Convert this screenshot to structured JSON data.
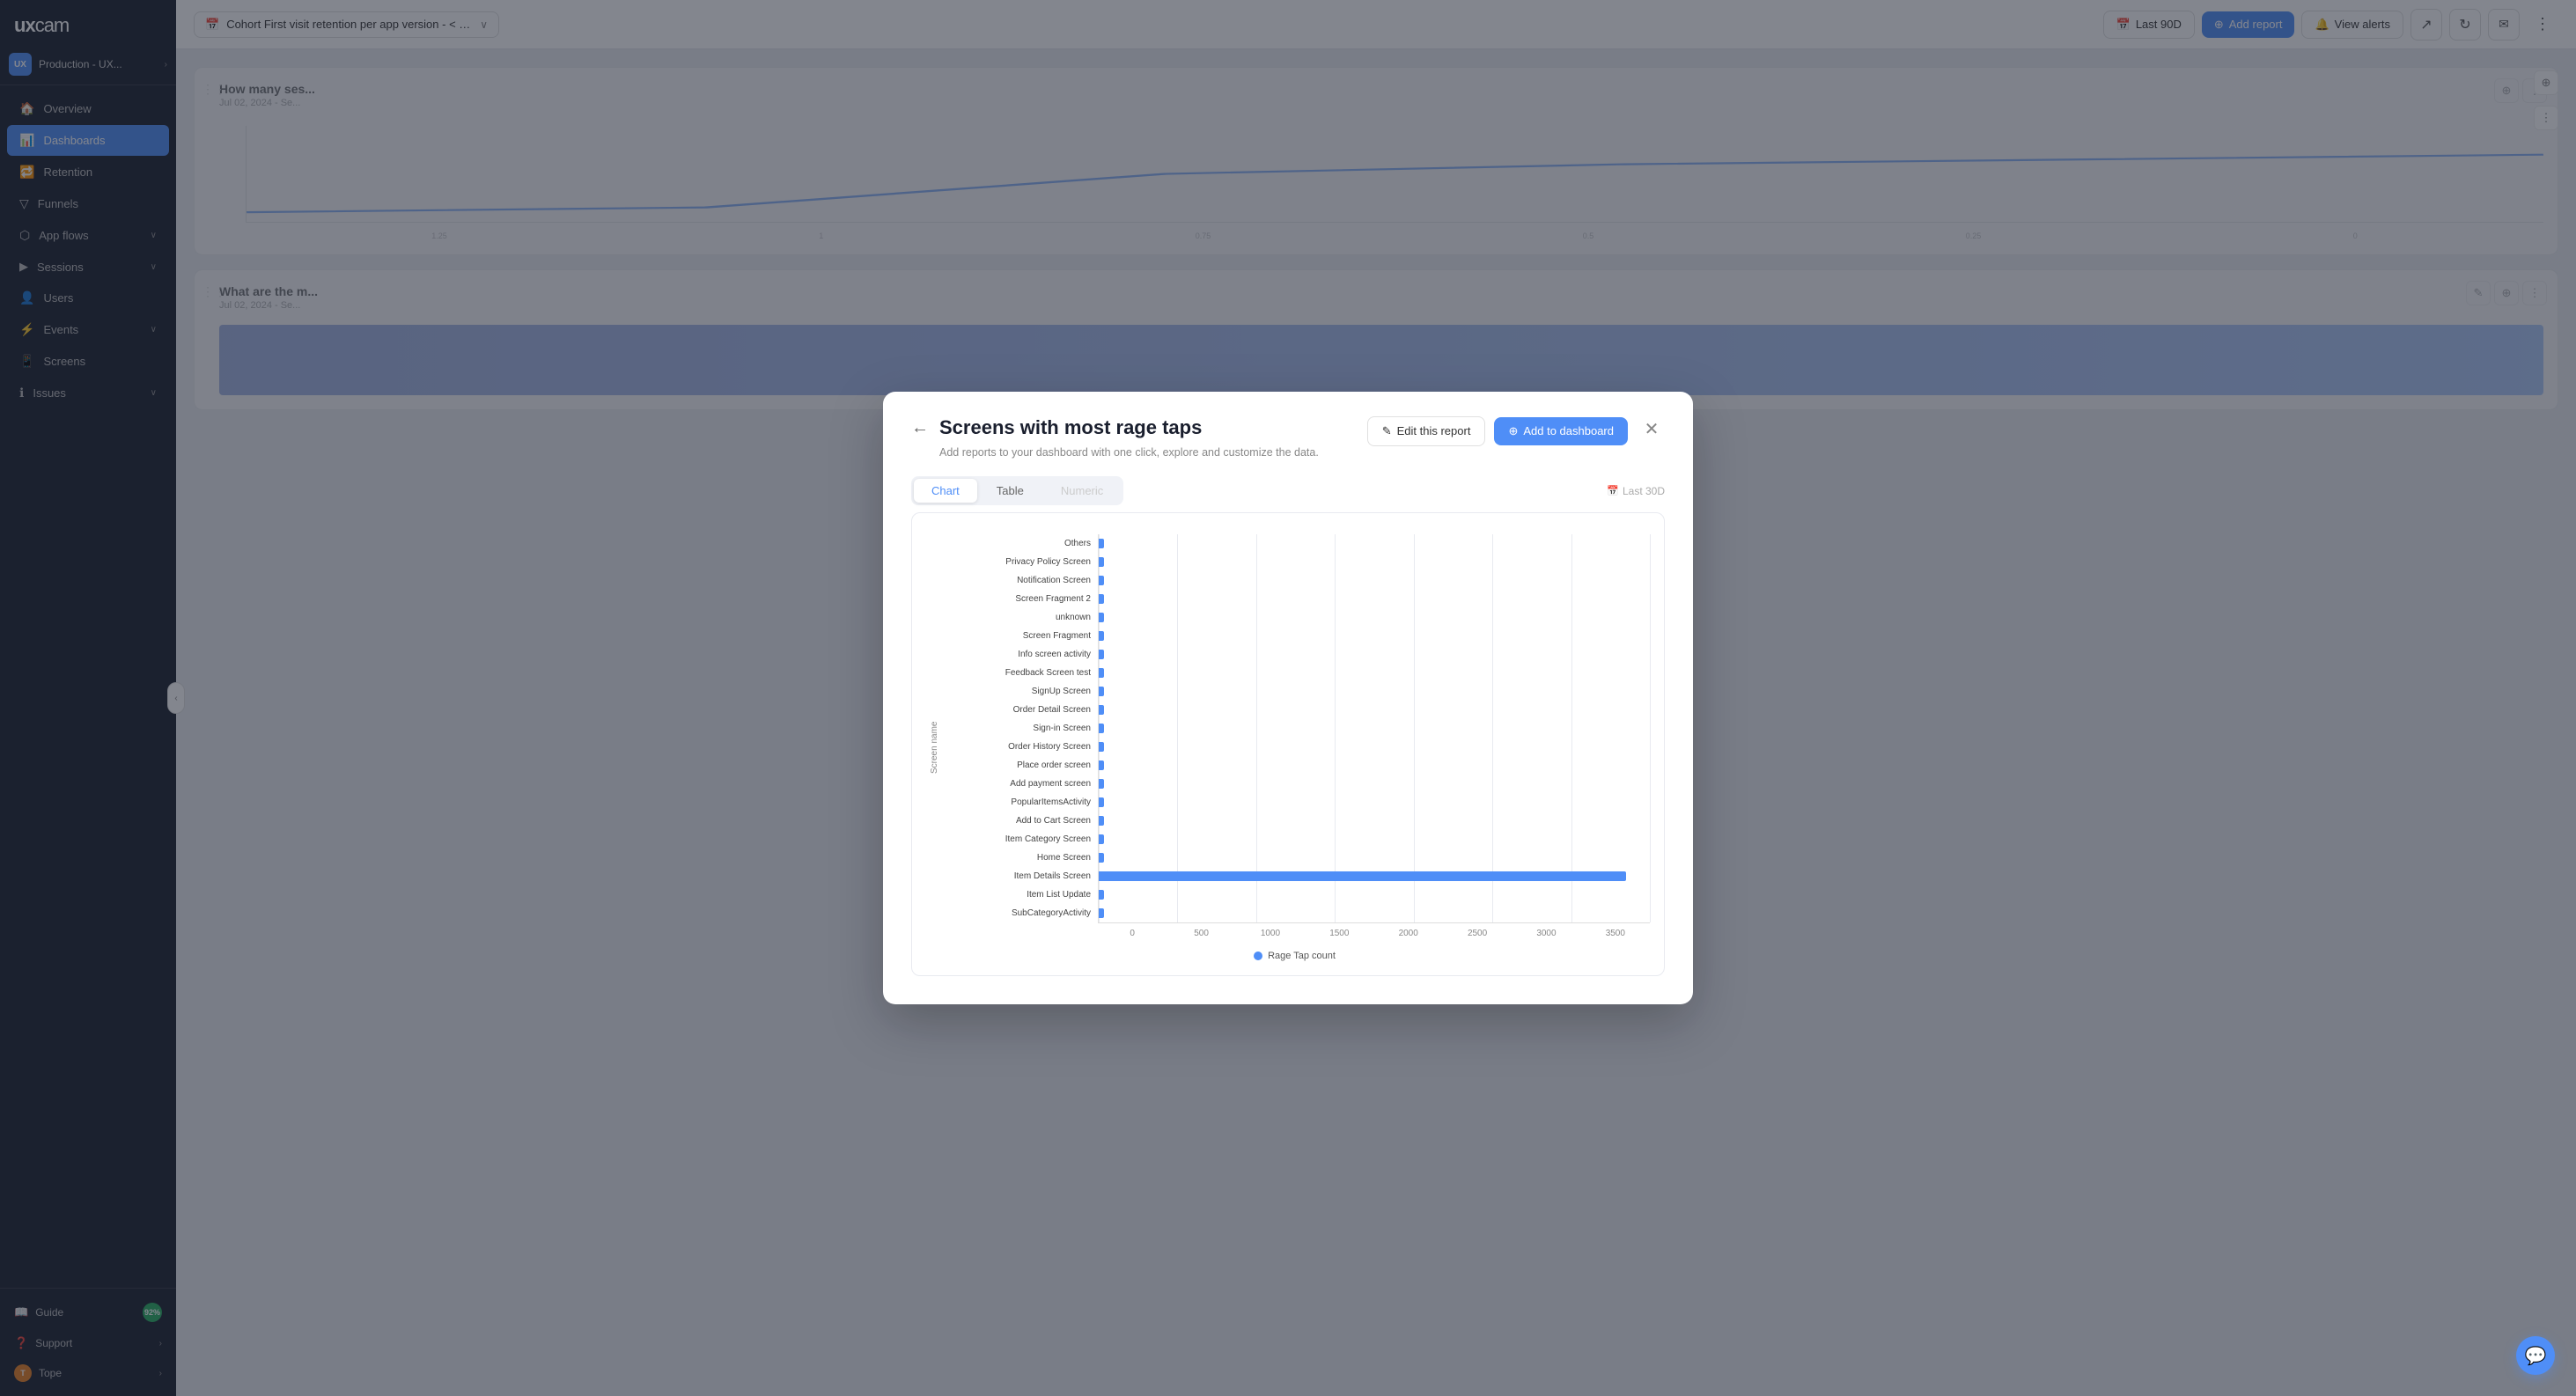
{
  "sidebar": {
    "logo": "uxcam",
    "user": {
      "label": "Production - UX...",
      "icon": "UX"
    },
    "nav_items": [
      {
        "id": "overview",
        "label": "Overview",
        "icon": "🏠",
        "active": false,
        "has_children": false
      },
      {
        "id": "dashboards",
        "label": "Dashboards",
        "icon": "📊",
        "active": true,
        "has_children": false
      },
      {
        "id": "retention",
        "label": "Retention",
        "icon": "🔁",
        "active": false,
        "has_children": false
      },
      {
        "id": "funnels",
        "label": "Funnels",
        "icon": "▽",
        "active": false,
        "has_children": false
      },
      {
        "id": "app-flows",
        "label": "App flows",
        "icon": "⬡",
        "active": false,
        "has_children": true
      },
      {
        "id": "sessions",
        "label": "Sessions",
        "icon": "▶",
        "active": false,
        "has_children": true
      },
      {
        "id": "users",
        "label": "Users",
        "icon": "👤",
        "active": false,
        "has_children": false
      },
      {
        "id": "events",
        "label": "Events",
        "icon": "⚡",
        "active": false,
        "has_children": true
      },
      {
        "id": "screens",
        "label": "Screens",
        "icon": "📱",
        "active": false,
        "has_children": false
      },
      {
        "id": "issues",
        "label": "Issues",
        "icon": "ℹ",
        "active": false,
        "has_children": true
      }
    ],
    "footer_items": [
      {
        "id": "guide",
        "label": "Guide",
        "badge": "92%"
      },
      {
        "id": "support",
        "label": "Support",
        "has_children": true
      },
      {
        "id": "tope",
        "label": "Tope",
        "has_children": true
      }
    ]
  },
  "topbar": {
    "report_title": "Cohort First visit retention per app version - < w...",
    "date_filter": "Last 90D",
    "add_report_btn": "Add report",
    "view_alerts_btn": "View alerts"
  },
  "modal": {
    "title": "Screens with most rage taps",
    "description": "Add reports to your dashboard with one click, explore and customize the data.",
    "edit_btn": "Edit this report",
    "add_dashboard_btn": "Add to dashboard",
    "tabs": [
      "Chart",
      "Table",
      "Numeric"
    ],
    "active_tab": "Chart",
    "period": "Last 30D",
    "chart": {
      "y_axis_label": "Screen name",
      "x_ticks": [
        "0",
        "500",
        "1000",
        "1500",
        "2000",
        "2500",
        "3000",
        "3500"
      ],
      "legend": "Rage Tap count",
      "bars": [
        {
          "label": "Others",
          "value": 0,
          "pct": 0.5
        },
        {
          "label": "Privacy Policy Screen",
          "value": 0,
          "pct": 0.5
        },
        {
          "label": "Notification Screen",
          "value": 0,
          "pct": 0.5
        },
        {
          "label": "Screen Fragment 2",
          "value": 0,
          "pct": 0.5
        },
        {
          "label": "unknown",
          "value": 0,
          "pct": 0.5
        },
        {
          "label": "Screen Fragment",
          "value": 0,
          "pct": 0.5
        },
        {
          "label": "Info screen activity",
          "value": 0,
          "pct": 0.5
        },
        {
          "label": "Feedback Screen test",
          "value": 0,
          "pct": 0.5
        },
        {
          "label": "SignUp Screen",
          "value": 0,
          "pct": 0.5
        },
        {
          "label": "Order Detail Screen",
          "value": 0,
          "pct": 0.5
        },
        {
          "label": "Sign-in Screen",
          "value": 0,
          "pct": 0.5
        },
        {
          "label": "Order History Screen",
          "value": 0,
          "pct": 0.5
        },
        {
          "label": "Place order screen",
          "value": 0,
          "pct": 0.5
        },
        {
          "label": "Add payment screen",
          "value": 0,
          "pct": 0.5
        },
        {
          "label": "PopularItemsActivity",
          "value": 0,
          "pct": 0.5
        },
        {
          "label": "Add to Cart Screen",
          "value": 0,
          "pct": 0.5
        },
        {
          "label": "Item Category Screen",
          "value": 0,
          "pct": 0.5
        },
        {
          "label": "Home Screen",
          "value": 0,
          "pct": 1.0
        },
        {
          "label": "Item Details Screen",
          "value": 3350,
          "pct": 96
        },
        {
          "label": "Item List Update",
          "value": 0,
          "pct": 0.5
        },
        {
          "label": "SubCategoryActivity",
          "value": 0,
          "pct": 0.5
        }
      ]
    }
  },
  "background_cards": [
    {
      "title": "How many ses...",
      "date": "Jul 02, 2024 - Se..."
    },
    {
      "title": "What are the m...",
      "date": "Jul 02, 2024 - Se..."
    }
  ]
}
